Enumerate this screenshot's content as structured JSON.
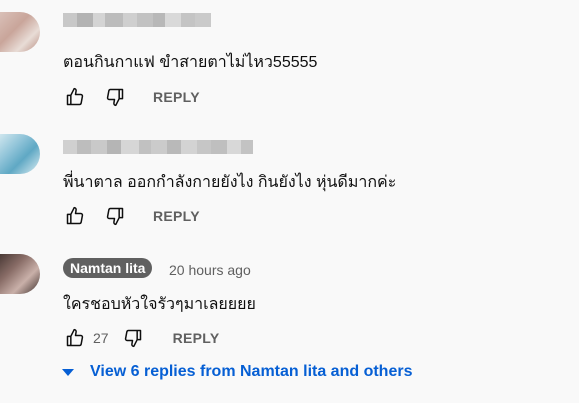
{
  "comments": [
    {
      "text": "ตอนกินกาแฟ ขำสายตาไม่ไหว55555",
      "reply_label": "REPLY"
    },
    {
      "text": "พี่นาตาล ออกกำลังกายยังไง กินยังไง หุ่นดีมากค่ะ",
      "reply_label": "REPLY"
    },
    {
      "author": "Namtan lita",
      "time": "20 hours ago",
      "text": "ใครชอบหัวใจรัวๆมาเลยยยย",
      "like_count": "27",
      "reply_label": "REPLY",
      "view_replies": "View 6 replies from Namtan lita and others"
    }
  ],
  "colors": {
    "link": "#065fd4",
    "secondary": "#606060",
    "chip": "#606060",
    "background": "#f9f9f9"
  },
  "icons": [
    "thumb-up-icon",
    "thumb-down-icon",
    "caret-down-icon"
  ]
}
